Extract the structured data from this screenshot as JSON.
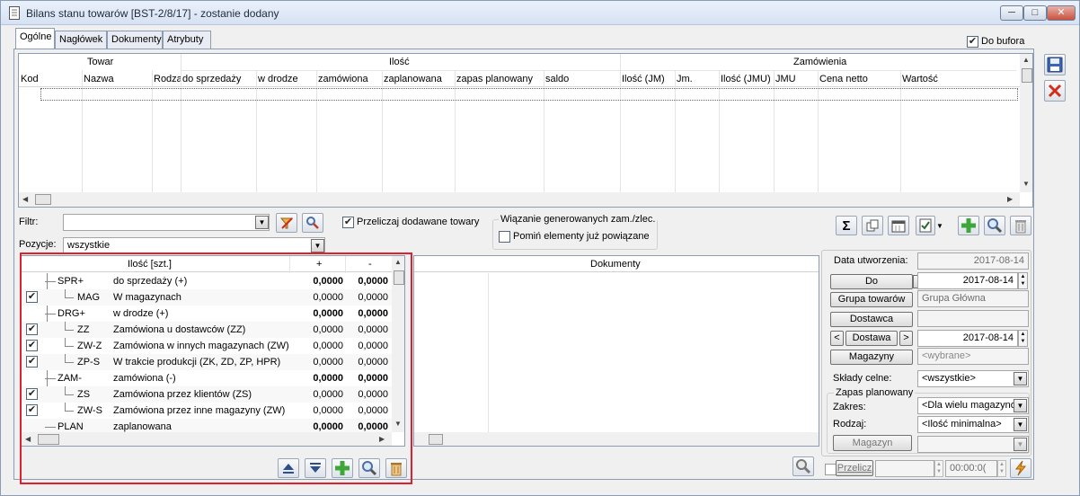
{
  "window": {
    "title": "Bilans stanu towarów [BST-2/8/17] - zostanie dodany",
    "minimize": "─",
    "maximize": "□",
    "close": "✕"
  },
  "tabs": [
    {
      "label": "Ogólne"
    },
    {
      "label": "Nagłówek"
    },
    {
      "label": "Dokumenty"
    },
    {
      "label": "Atrybuty"
    }
  ],
  "do_bufora": {
    "label": "Do bufora",
    "checked": true
  },
  "top_grid": {
    "groups": {
      "towar": "Towar",
      "ilosc": "Ilość",
      "zamowienia": "Zamówienia"
    },
    "columns": [
      "Kod",
      "Nazwa",
      "Rodza",
      "do sprzedaży",
      "w drodze",
      "zamówiona",
      "zaplanowana",
      "zapas planowany",
      "saldo",
      "Ilość (JM)",
      "Jm.",
      "Ilość (JMU)",
      "JMU",
      "Cena netto",
      "Wartość"
    ]
  },
  "filter": {
    "label": "Filtr:",
    "value": "",
    "przeliczaj_label": "Przeliczaj dodawane towary",
    "przeliczaj_checked": true
  },
  "wiazanie": {
    "group_label": "Wiązanie generowanych zam./zlec.",
    "pomin_label": "Pomiń elementy już powiązane",
    "pomin_checked": false
  },
  "pozycje": {
    "label": "Pozycje:",
    "value": "wszystkie"
  },
  "tree_grid": {
    "headers": {
      "ilosc": "Ilość [szt.]",
      "plus": "+",
      "minus": "-"
    },
    "rows": [
      {
        "code": "SPR+",
        "desc": "do sprzedaży (+)",
        "plus": "0,0000",
        "minus": "0,0000",
        "checked": false,
        "level": 0,
        "bold": true
      },
      {
        "code": "MAG",
        "desc": "W magazynach",
        "plus": "0,0000",
        "minus": "0,0000",
        "checked": true,
        "level": 1,
        "bold": false
      },
      {
        "code": "DRG+",
        "desc": "w drodze (+)",
        "plus": "0,0000",
        "minus": "0,0000",
        "checked": false,
        "level": 0,
        "bold": true
      },
      {
        "code": "ZZ",
        "desc": "Zamówiona u dostawców (ZZ)",
        "plus": "0,0000",
        "minus": "0,0000",
        "checked": true,
        "level": 1,
        "bold": false
      },
      {
        "code": "ZW-Z",
        "desc": "Zamówiona w innych magazynach (ZW)",
        "plus": "0,0000",
        "minus": "0,0000",
        "checked": true,
        "level": 1,
        "bold": false
      },
      {
        "code": "ZP-S",
        "desc": "W trakcie produkcji (ZK, ZD, ZP, HPR)",
        "plus": "0,0000",
        "minus": "0,0000",
        "checked": true,
        "level": 1,
        "bold": false
      },
      {
        "code": "ZAM-",
        "desc": "zamówiona (-)",
        "plus": "0,0000",
        "minus": "0,0000",
        "checked": false,
        "level": 0,
        "bold": true
      },
      {
        "code": "ZS",
        "desc": "Zamówiona przez klientów (ZS)",
        "plus": "0,0000",
        "minus": "0,0000",
        "checked": true,
        "level": 1,
        "bold": false
      },
      {
        "code": "ZW-S",
        "desc": "Zamówiona przez inne magazyny (ZW)",
        "plus": "0,0000",
        "minus": "0,0000",
        "checked": true,
        "level": 1,
        "bold": false
      },
      {
        "code": "PLAN",
        "desc": "zaplanowana",
        "plus": "0,0000",
        "minus": "0,0000",
        "checked": false,
        "level": 0,
        "bold": true
      }
    ]
  },
  "documents_grid": {
    "header": "Dokumenty"
  },
  "right_panel": {
    "data_utworzenia_label": "Data utworzenia:",
    "data_utworzenia": "2017-08-14",
    "do_label": "Do",
    "do_date": "2017-08-14",
    "grupa_label": "Grupa towarów",
    "grupa_value": "Grupa Główna",
    "dostawca_label": "Dostawca",
    "dostawca_value": "",
    "dostawa_label": "Dostawa",
    "dostawa_prev": "<",
    "dostawa_next": ">",
    "dostawa_date": "2017-08-14",
    "magazyny_label": "Magazyny",
    "magazyny_value": "<wybrane>",
    "sklady_label": "Składy celne:",
    "sklady_value": "<wszystkie>",
    "zapas_group": "Zapas planowany",
    "zakres_label": "Zakres:",
    "zakres_value": "<Dla wielu magazyno",
    "rodzaj_label": "Rodzaj:",
    "rodzaj_value": "<Ilość minimalna>",
    "magazyn_label": "Magazyn",
    "przelicz_label": "Przelicz",
    "time_value": "00:00:0("
  },
  "colors": {
    "highlight_box": "#e0202e",
    "title_text": "#1e2a3a"
  }
}
